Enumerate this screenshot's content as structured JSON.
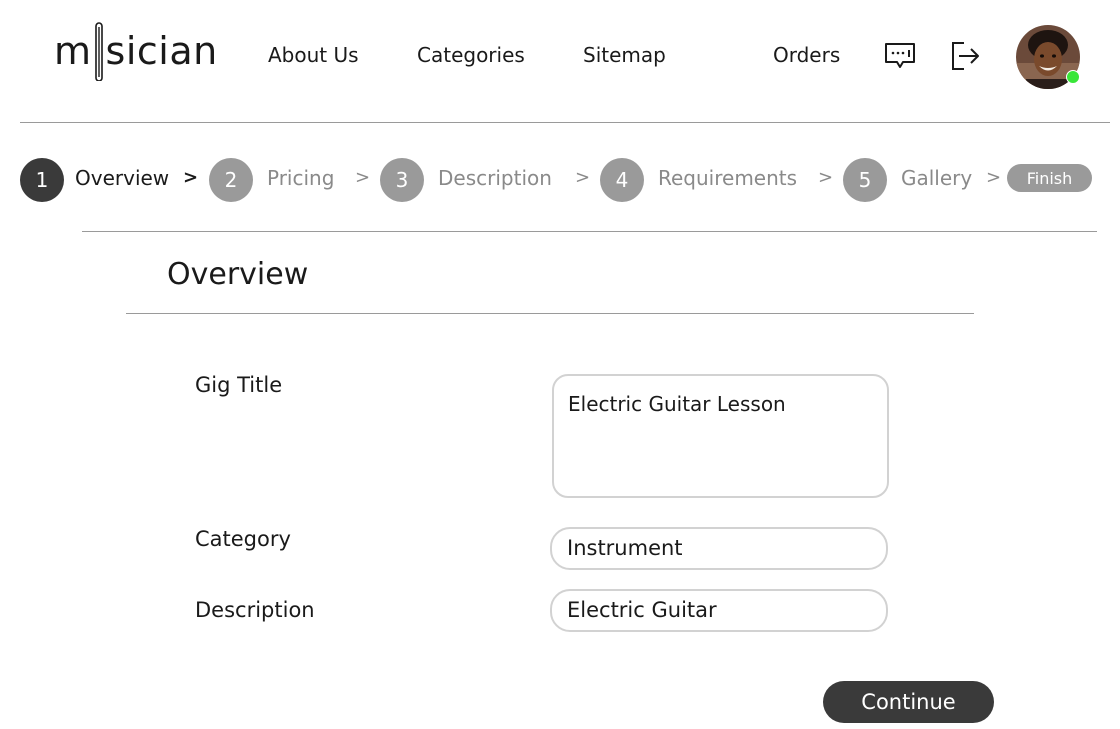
{
  "brand": {
    "logo_left": "m",
    "logo_right": "sician"
  },
  "nav": {
    "links": [
      "About Us",
      "Categories",
      "Sitemap",
      "Orders"
    ],
    "icons": [
      "chat-icon",
      "logout-icon"
    ]
  },
  "user": {
    "status": "online"
  },
  "stepper": {
    "steps": [
      {
        "number": "1",
        "label": "Overview",
        "active": true
      },
      {
        "number": "2",
        "label": "Pricing",
        "active": false
      },
      {
        "number": "3",
        "label": "Description",
        "active": false
      },
      {
        "number": "4",
        "label": "Requirements",
        "active": false
      },
      {
        "number": "5",
        "label": "Gallery",
        "active": false
      }
    ],
    "separator": ">",
    "finish_label": "Finish"
  },
  "form": {
    "title": "Overview",
    "fields": [
      {
        "label": "Gig Title",
        "value": "Electric Guitar Lesson"
      },
      {
        "label": "Category",
        "value": "Instrument"
      },
      {
        "label": "Description",
        "value": "Electric Guitar"
      }
    ],
    "continue_label": "Continue"
  },
  "colors": {
    "dark": "#3a3a3a",
    "inactive": "#9a9a9a",
    "inactive_text": "#8a8a8a",
    "online": "#39e639",
    "divider": "#9a9a9a",
    "field_border": "#d2d2d2"
  }
}
